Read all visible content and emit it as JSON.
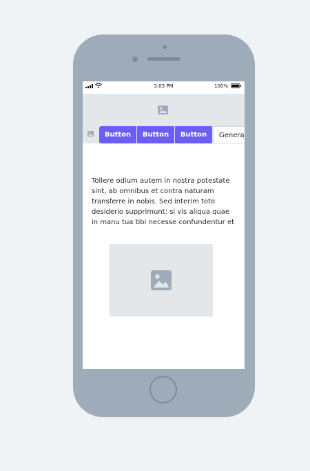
{
  "status_bar": {
    "time": "3:03 PM",
    "battery": "100%"
  },
  "header": {
    "icon": "image-icon"
  },
  "tabs": [
    {
      "label": "Button"
    },
    {
      "label": "Button"
    },
    {
      "label": "Button"
    },
    {
      "label": "Generac"
    }
  ],
  "content": {
    "paragraph": "Tollere odium autem in nostra potestate sint, ab omnibus et contra naturam transferre in nobis. Sed interim toto desiderio supprimunt: si vis aliqua quae in manu tua tibi necesse confundentur et",
    "image_icon": "image-icon"
  },
  "colors": {
    "phone_body": "#9eabb8",
    "accent": "#6c5ef5",
    "placeholder_bg": "#e4e7ea"
  }
}
